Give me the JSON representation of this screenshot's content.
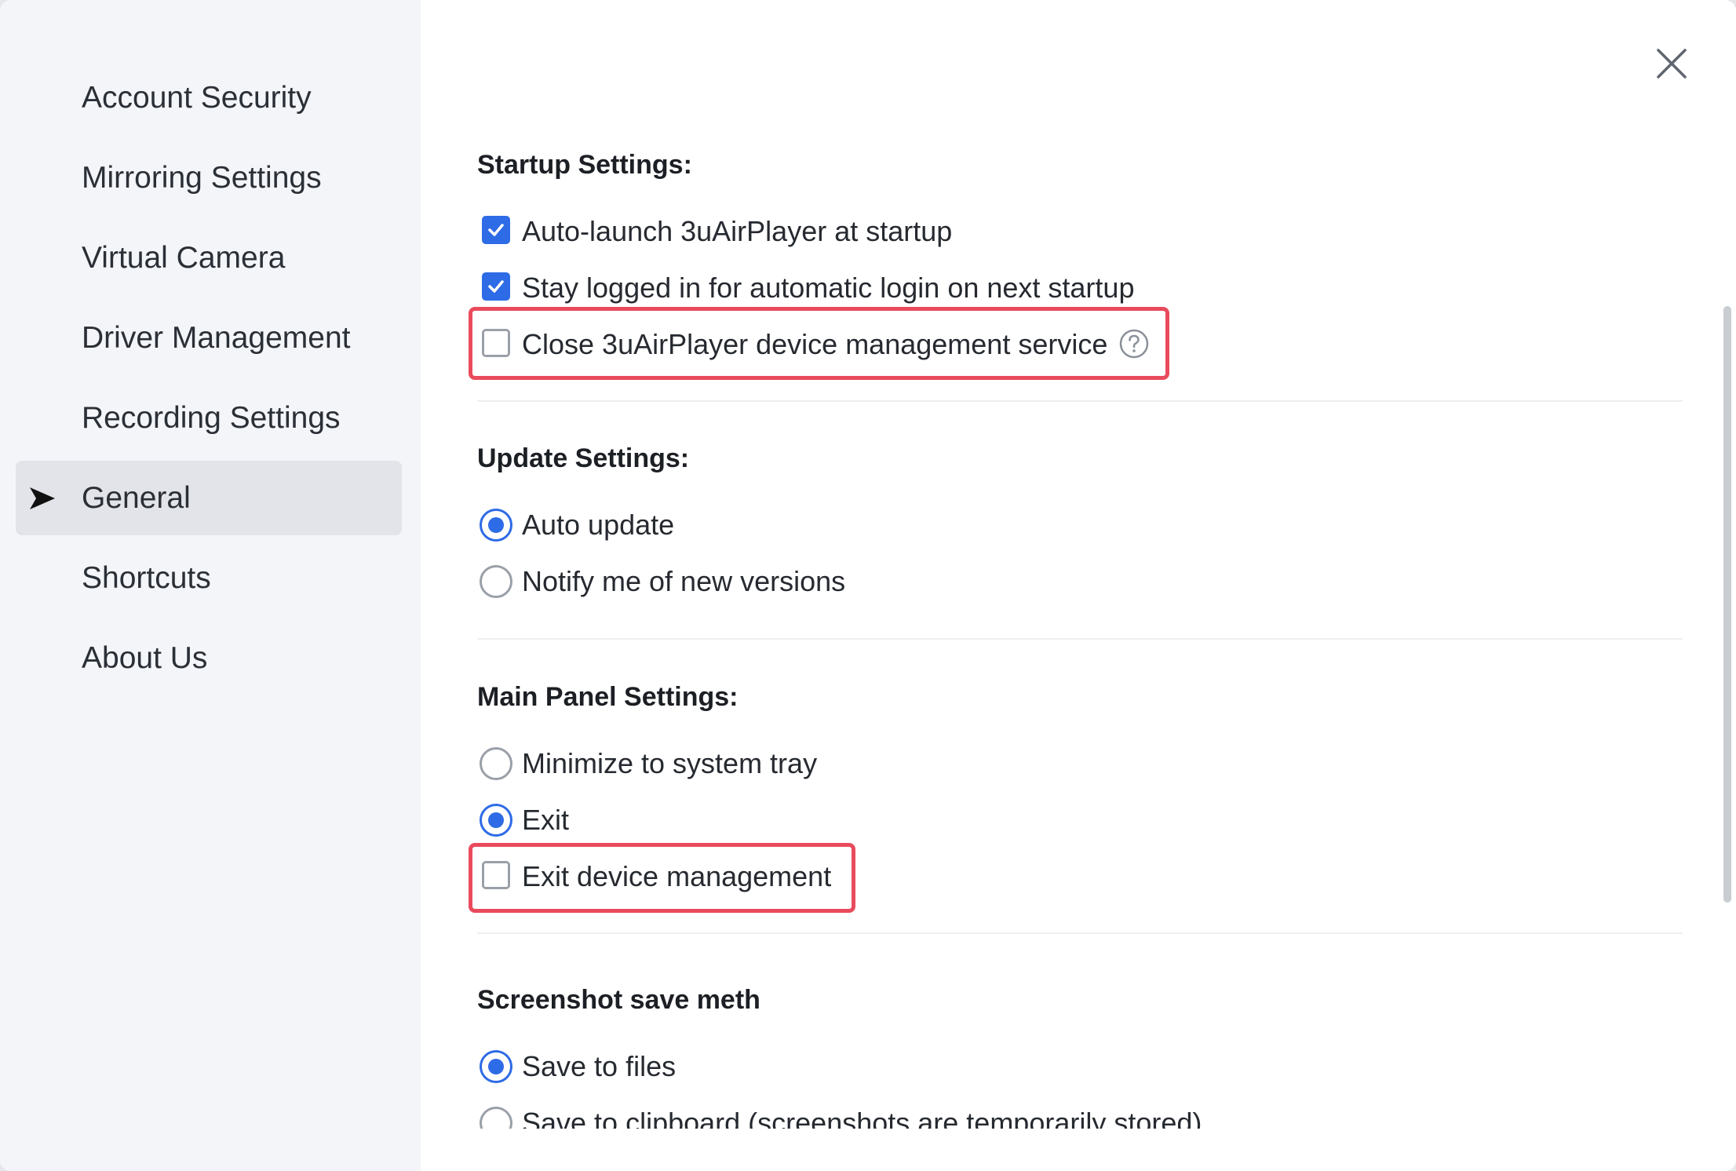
{
  "sidebar": {
    "items": [
      {
        "label": "Account Security"
      },
      {
        "label": "Mirroring Settings"
      },
      {
        "label": "Virtual Camera"
      },
      {
        "label": "Driver Management"
      },
      {
        "label": "Recording Settings"
      },
      {
        "label": "General",
        "active": true
      },
      {
        "label": "Shortcuts"
      },
      {
        "label": "About Us"
      }
    ]
  },
  "sections": {
    "startup": {
      "title": "Startup Settings:",
      "options": [
        {
          "label": "Auto-launch 3uAirPlayer at startup",
          "checked": true
        },
        {
          "label": "Stay logged in for automatic login on next startup",
          "checked": true
        },
        {
          "label": "Close 3uAirPlayer device management service",
          "checked": false
        }
      ]
    },
    "update": {
      "title": "Update Settings:",
      "options": [
        {
          "label": "Auto update",
          "selected": true
        },
        {
          "label": "Notify me of new versions",
          "selected": false
        }
      ]
    },
    "main_panel": {
      "title": "Main Panel Settings:",
      "options": [
        {
          "label": "Minimize to system tray",
          "selected": false
        },
        {
          "label": "Exit",
          "selected": true
        },
        {
          "label": "Exit device management",
          "checked": false
        }
      ]
    },
    "screenshot": {
      "title": "Screenshot save meth",
      "options": [
        {
          "label": "Save to files",
          "selected": true
        },
        {
          "label": "Save to clipboard (screenshots are temporarily stored)",
          "selected": false
        }
      ]
    }
  },
  "colors": {
    "accent": "#2e6be6",
    "highlight": "#e94b5c",
    "sidebar_bg": "#f3f5f9",
    "active_bg": "#e2e4e9"
  },
  "icons": {
    "close": "close-icon",
    "help": "help-icon",
    "active_arrow": "arrow-right-icon"
  }
}
